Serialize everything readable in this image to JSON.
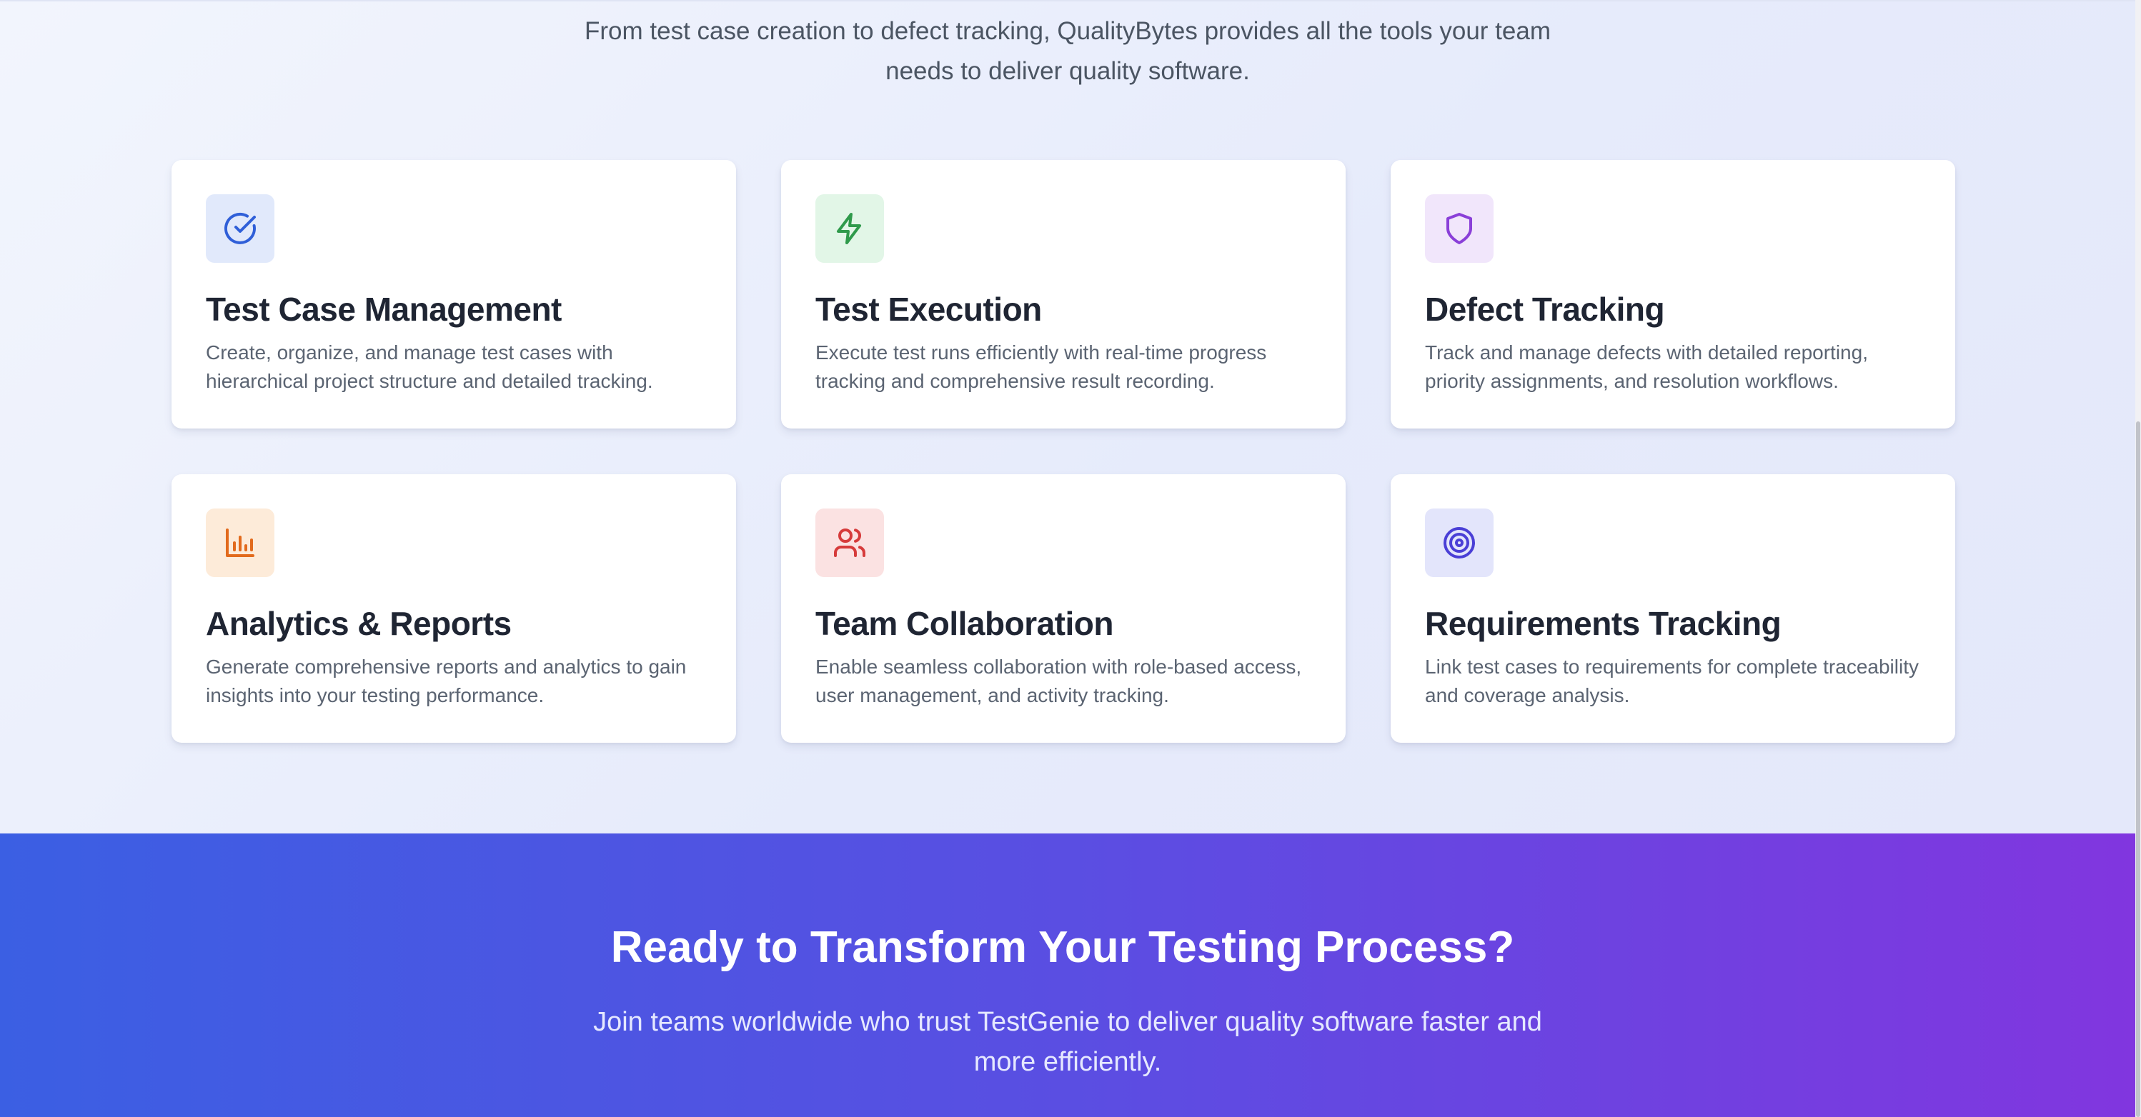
{
  "features": {
    "subtitle": "From test case creation to defect tracking, QualityBytes provides all the tools your team needs to deliver quality software.",
    "cards": [
      {
        "icon": "check-circle-icon",
        "icon_color": "#2f5fd8",
        "icon_bg": "#e1e9fb",
        "title": "Test Case Management",
        "description": "Create, organize, and manage test cases with hierarchical project structure and detailed tracking."
      },
      {
        "icon": "lightning-bolt-icon",
        "icon_color": "#2f9a4b",
        "icon_bg": "#e2f6e7",
        "title": "Test Execution",
        "description": "Execute test runs efficiently with real-time progress tracking and comprehensive result recording."
      },
      {
        "icon": "shield-icon",
        "icon_color": "#8a3fd8",
        "icon_bg": "#f1e6fb",
        "title": "Defect Tracking",
        "description": "Track and manage defects with detailed reporting, priority assignments, and resolution workflows."
      },
      {
        "icon": "bar-chart-icon",
        "icon_color": "#e26a1c",
        "icon_bg": "#fdebd9",
        "title": "Analytics & Reports",
        "description": "Generate comprehensive reports and analytics to gain insights into your testing performance."
      },
      {
        "icon": "users-icon",
        "icon_color": "#d63b3b",
        "icon_bg": "#fbe2e2",
        "title": "Team Collaboration",
        "description": "Enable seamless collaboration with role-based access, user management, and activity tracking."
      },
      {
        "icon": "target-icon",
        "icon_color": "#4a3fd6",
        "icon_bg": "#e3e5fb",
        "title": "Requirements Tracking",
        "description": "Link test cases to requirements for complete traceability and coverage analysis."
      }
    ]
  },
  "cta": {
    "title": "Ready to Transform Your Testing Process?",
    "text": "Join teams worldwide who trust TestGenie to deliver quality software faster and more efficiently.",
    "gradient_start": "#3b5fe3",
    "gradient_end": "#8136df"
  }
}
